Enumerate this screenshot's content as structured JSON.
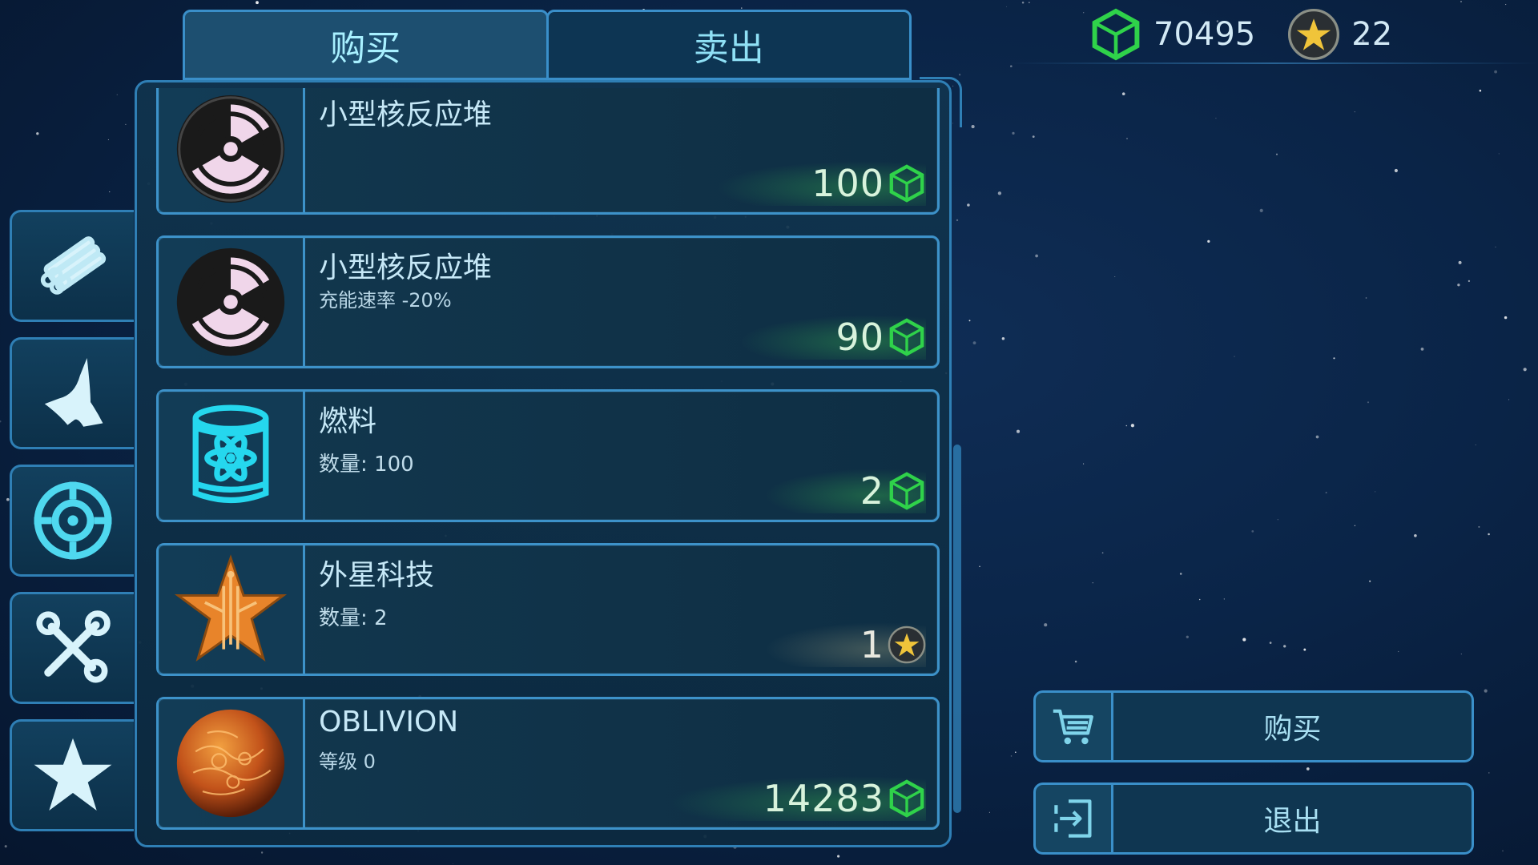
{
  "tabs": [
    {
      "label": "购买",
      "active": true
    },
    {
      "label": "卖出",
      "active": false
    }
  ],
  "sidebar": {
    "items": [
      {
        "icon": "pipes-icon"
      },
      {
        "icon": "ship-hull-icon"
      },
      {
        "icon": "target-icon"
      },
      {
        "icon": "tools-icon"
      },
      {
        "icon": "star-icon"
      }
    ]
  },
  "currency": {
    "credits": "70495",
    "credits_icon": "green-cube-icon",
    "stars": "22",
    "stars_icon": "star-coin-icon"
  },
  "items": [
    {
      "title": "小型核反应堆",
      "subtitle": "",
      "price": "100",
      "price_icon": "green-cube-icon",
      "icon": "radiation-icon"
    },
    {
      "title": "小型核反应堆",
      "subtitle": "充能速率 -20%",
      "price": "90",
      "price_icon": "green-cube-icon",
      "icon": "radiation-icon"
    },
    {
      "title": "燃料",
      "subtitle": "数量: 100",
      "price": "2",
      "price_icon": "green-cube-icon",
      "icon": "fuel-barrel-icon"
    },
    {
      "title": "外星科技",
      "subtitle": "数量: 2",
      "price": "1",
      "price_icon": "star-coin-icon",
      "icon": "alien-tech-star-icon"
    },
    {
      "title": "OBLIVION",
      "subtitle": "等级 0",
      "price": "14283",
      "price_icon": "green-cube-icon",
      "icon": "oblivion-orb-icon"
    }
  ],
  "actions": {
    "buy_label": "购买",
    "buy_icon": "cart-icon",
    "exit_label": "退出",
    "exit_icon": "exit-icon"
  },
  "colors": {
    "accent_blue": "#3a8fc9",
    "credit_green": "#2fd24a",
    "text_cyan": "#8fe0f5"
  }
}
